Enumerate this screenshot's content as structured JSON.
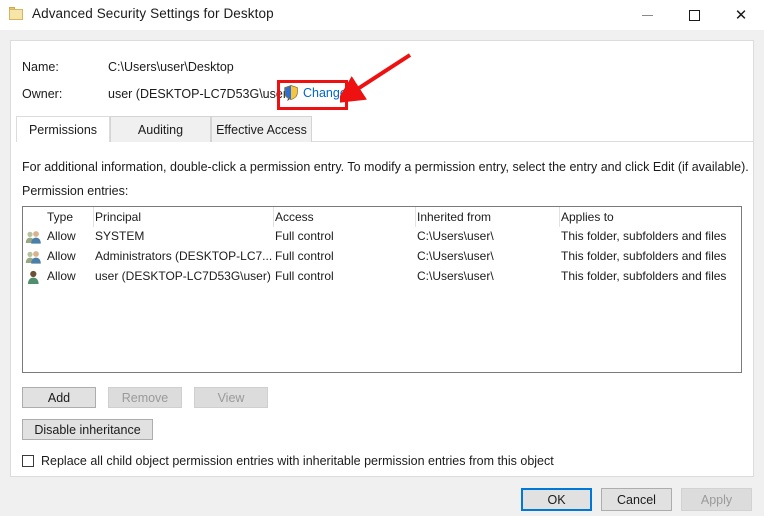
{
  "window": {
    "title": "Advanced Security Settings for Desktop",
    "icon": "folder-icon",
    "controls": {
      "minimize": "–",
      "maximize": "□",
      "close": "✕"
    }
  },
  "header": {
    "name_label": "Name:",
    "name_value": "C:\\Users\\user\\Desktop",
    "owner_label": "Owner:",
    "owner_value": "user (DESKTOP-LC7D53G\\user)",
    "change_link": "Change",
    "change_icon": "uac-shield-icon"
  },
  "annotation": {
    "highlight_color": "#ee1111",
    "arrow_color": "#ee1111",
    "target": "Change"
  },
  "tabs": [
    {
      "label": "Permissions",
      "active": true
    },
    {
      "label": "Auditing",
      "active": false
    },
    {
      "label": "Effective Access",
      "active": false
    }
  ],
  "main": {
    "info_text": "For additional information, double-click a permission entry. To modify a permission entry, select the entry and click Edit (if available).",
    "entries_label": "Permission entries:",
    "columns": [
      "Type",
      "Principal",
      "Access",
      "Inherited from",
      "Applies to"
    ],
    "rows": [
      {
        "icon": "group-icon",
        "type": "Allow",
        "principal": "SYSTEM",
        "access": "Full control",
        "inherited_from": "C:\\Users\\user\\",
        "applies_to": "This folder, subfolders and files"
      },
      {
        "icon": "group-icon",
        "type": "Allow",
        "principal": "Administrators (DESKTOP-LC7...",
        "access": "Full control",
        "inherited_from": "C:\\Users\\user\\",
        "applies_to": "This folder, subfolders and files"
      },
      {
        "icon": "user-icon",
        "type": "Allow",
        "principal": "user (DESKTOP-LC7D53G\\user)",
        "access": "Full control",
        "inherited_from": "C:\\Users\\user\\",
        "applies_to": "This folder, subfolders and files"
      }
    ],
    "buttons": {
      "add": "Add",
      "remove": "Remove",
      "view": "View",
      "disable_inheritance": "Disable inheritance"
    },
    "checkbox": {
      "label": "Replace all child object permission entries with inheritable permission entries from this object",
      "checked": false
    }
  },
  "footer": {
    "ok": "OK",
    "cancel": "Cancel",
    "apply": "Apply"
  }
}
